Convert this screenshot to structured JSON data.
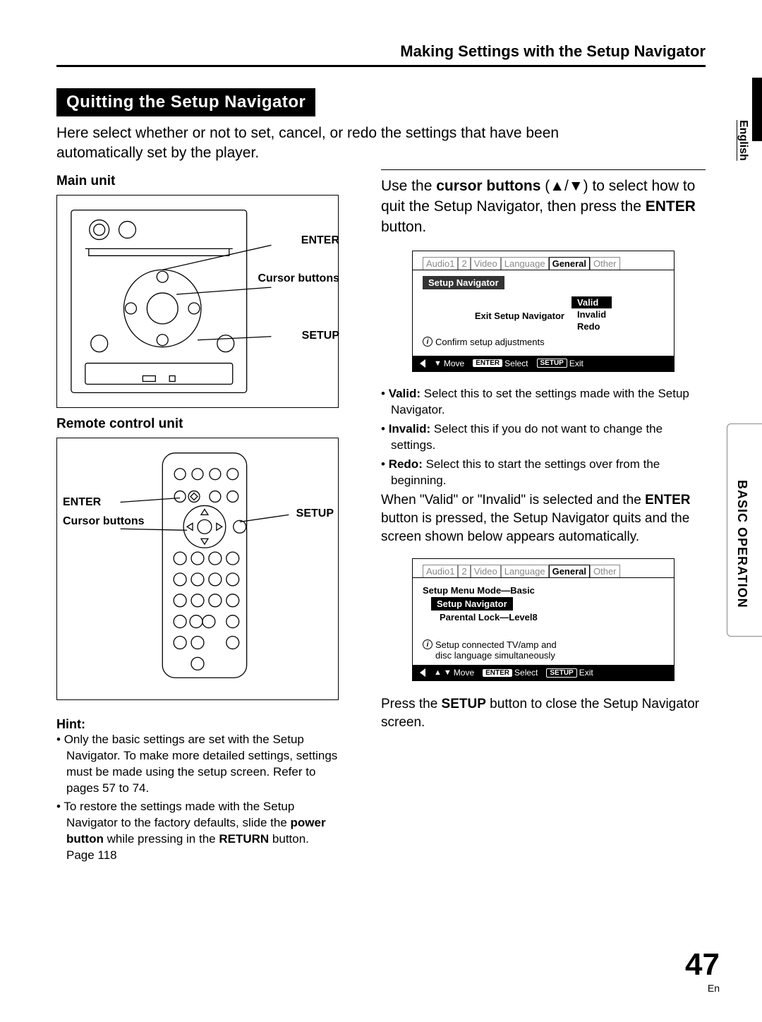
{
  "chapter_head": "Making Settings with the Setup Navigator",
  "language_tab": "English",
  "section_tab": "BASIC OPERATION",
  "title_bar": "Quitting the Setup Navigator",
  "intro": "Here select whether or not to set, cancel, or redo the settings that have been automatically set by the player.",
  "main_unit_label": "Main unit",
  "remote_label": "Remote control unit",
  "callouts": {
    "enter": "ENTER",
    "cursor": "Cursor buttons",
    "setup": "SETUP"
  },
  "hint_label": "Hint:",
  "hints": [
    "Only the basic settings are set with the Setup Navigator.  To make more detailed settings, settings must be made using the setup screen.  Refer to pages 57 to 74.",
    "To restore the settings made with the Setup Navigator to the factory defaults, slide the power button while pressing in the RETURN button.  Page 118"
  ],
  "lead_pre": "Use the ",
  "lead_cursor": "cursor buttons",
  "lead_sym": " (▲/▼) to select how to quit the Setup Navigator, then press the ",
  "lead_enter": "ENTER",
  "lead_post": " button.",
  "osd_tabs": [
    "Audio1",
    "2",
    "Video",
    "Language",
    "General",
    "Other"
  ],
  "osd_tabs_selected": 4,
  "osd1": {
    "header": "Setup Navigator",
    "row_label": "Exit Setup Navigator",
    "options": [
      "Valid",
      "Invalid",
      "Redo"
    ],
    "selected": 0,
    "info": "Confirm setup adjustments"
  },
  "nav": {
    "move": "Move",
    "select": "Select",
    "setup": "SETUP",
    "exit": "Exit",
    "enter": "ENTER"
  },
  "optdesc": [
    {
      "h": "Valid:",
      "t": "  Select this to set the settings made with the Setup Navigator."
    },
    {
      "h": "Invalid:",
      "t": "  Select this if you do not want to change the settings."
    },
    {
      "h": "Redo:",
      "t": "  Select this to start the settings over from the beginning."
    }
  ],
  "after_opts_1": "When \"Valid\" or \"Invalid\" is selected and the ",
  "after_opts_b": "ENTER",
  "after_opts_2": " button is pressed, the Setup Navigator quits and the screen shown below appears automatically.",
  "osd2": {
    "row1": "Setup Menu Mode—Basic",
    "row2": "Setup Navigator",
    "row3": "Parental Lock—Level8",
    "info1": "Setup connected TV/amp and",
    "info2": "disc language simultaneously"
  },
  "press_1": "Press the ",
  "press_b": "SETUP",
  "press_2": " button to close the Setup Navigator screen.",
  "pageno": "47",
  "pageno_lang": "En"
}
